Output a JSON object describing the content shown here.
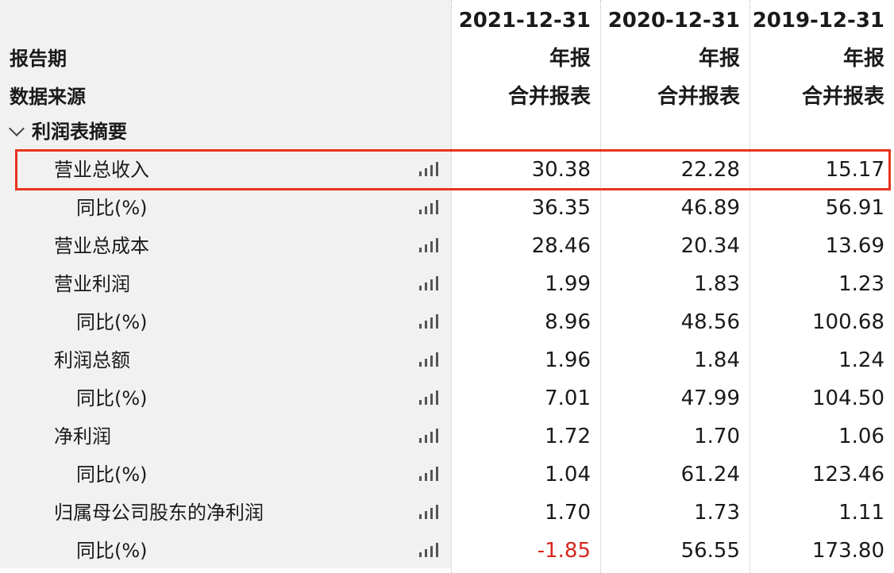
{
  "header": {
    "dates": [
      "2021-12-31",
      "2020-12-31",
      "2019-12-31"
    ],
    "period_label": "报告期",
    "period_values": [
      "年报",
      "年报",
      "年报"
    ],
    "source_label": "数据来源",
    "source_values": [
      "合并报表",
      "合并报表",
      "合并报表"
    ]
  },
  "section": {
    "title": "利润表摘要",
    "icon": "chevron-down-icon"
  },
  "rows": [
    {
      "label": "营业总收入",
      "indent": 1,
      "values": [
        "30.38",
        "22.28",
        "15.17"
      ],
      "highlighted": true
    },
    {
      "label": "同比(%)",
      "indent": 2,
      "values": [
        "36.35",
        "46.89",
        "56.91"
      ]
    },
    {
      "label": "营业总成本",
      "indent": 1,
      "values": [
        "28.46",
        "20.34",
        "13.69"
      ]
    },
    {
      "label": "营业利润",
      "indent": 1,
      "values": [
        "1.99",
        "1.83",
        "1.23"
      ]
    },
    {
      "label": "同比(%)",
      "indent": 2,
      "values": [
        "8.96",
        "48.56",
        "100.68"
      ]
    },
    {
      "label": "利润总额",
      "indent": 1,
      "values": [
        "1.96",
        "1.84",
        "1.24"
      ]
    },
    {
      "label": "同比(%)",
      "indent": 2,
      "values": [
        "7.01",
        "47.99",
        "104.50"
      ]
    },
    {
      "label": "净利润",
      "indent": 1,
      "values": [
        "1.72",
        "1.70",
        "1.06"
      ]
    },
    {
      "label": "同比(%)",
      "indent": 2,
      "values": [
        "1.04",
        "61.24",
        "123.46"
      ]
    },
    {
      "label": "归属母公司股东的净利润",
      "indent": 1,
      "values": [
        "1.70",
        "1.73",
        "1.11"
      ]
    },
    {
      "label": "同比(%)",
      "indent": 2,
      "values": [
        "-1.85",
        "56.55",
        "173.80"
      ]
    }
  ],
  "colors": {
    "highlight_border": "#e8341c",
    "negative": "#d7261f",
    "label_bg": "#f1f1f1"
  },
  "row_icon": "bar-chart-icon"
}
